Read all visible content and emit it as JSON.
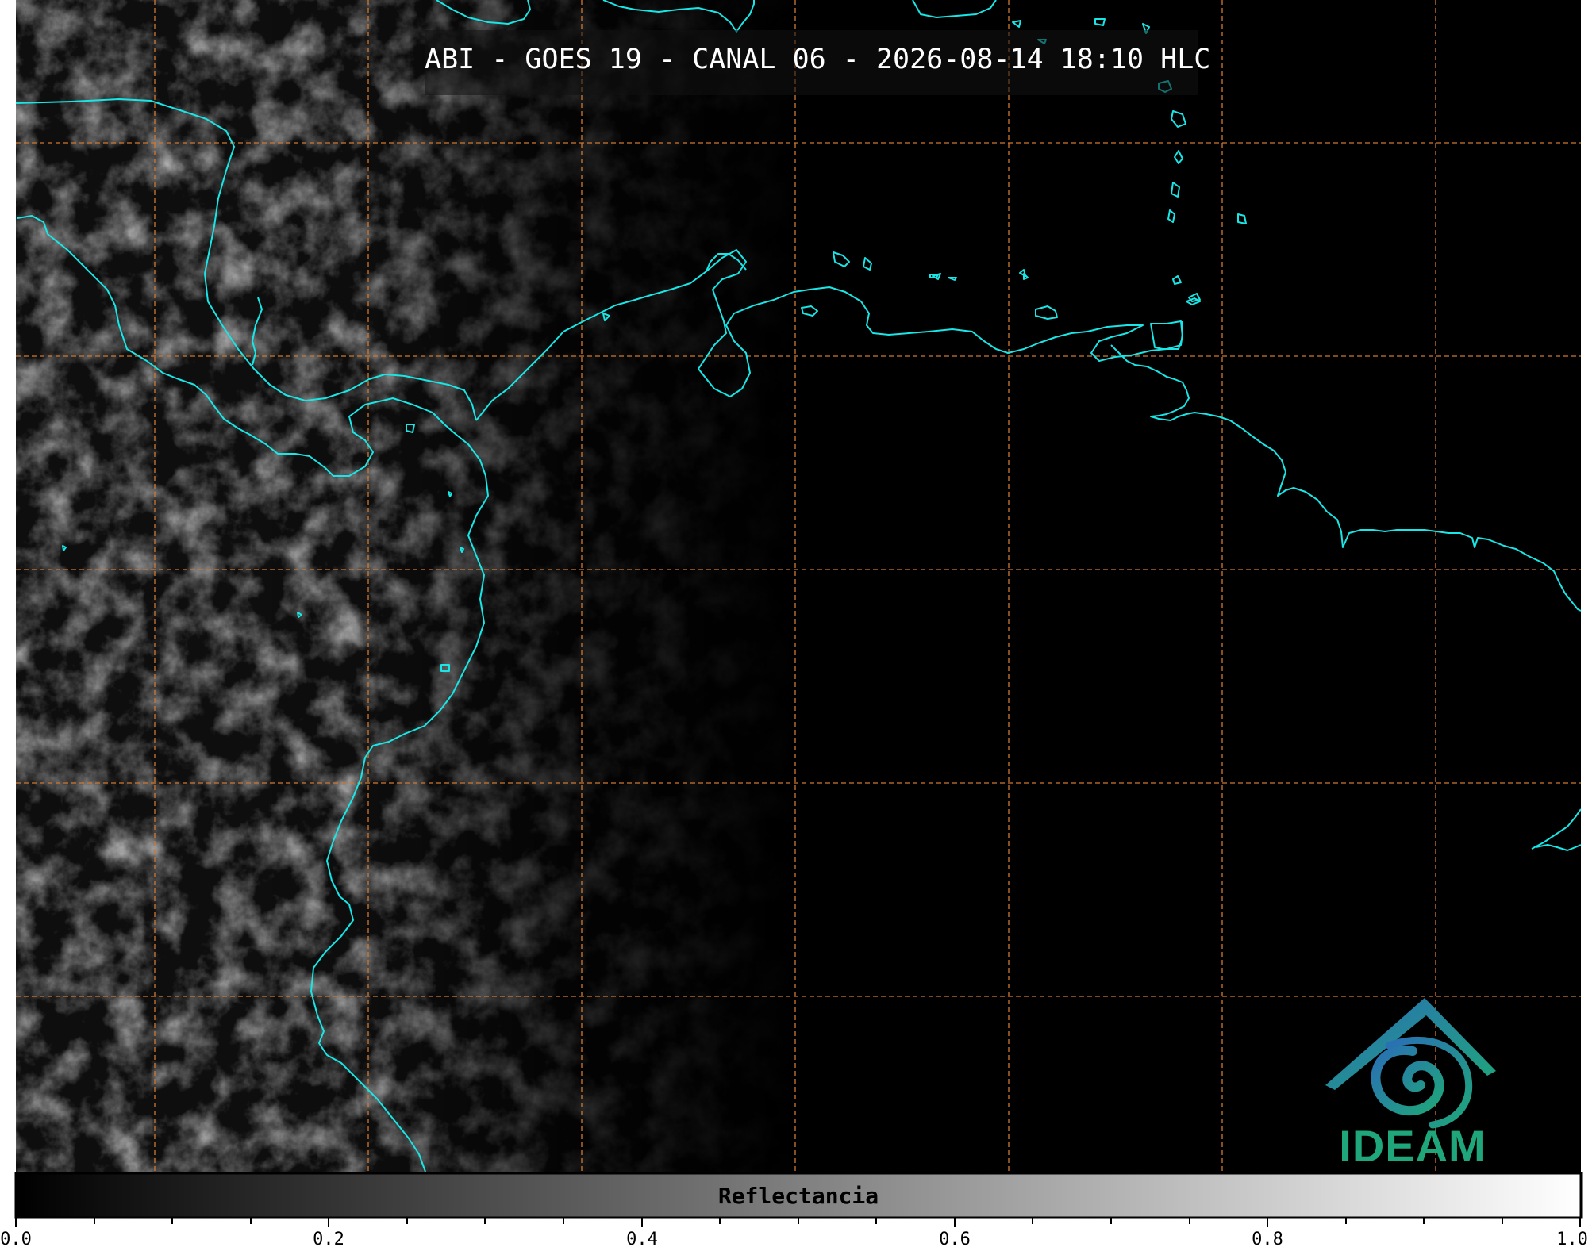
{
  "title": "ABI - GOES 19 - CANAL 06 - 2026-08-14 18:10 HLC",
  "colorbar": {
    "label": "Reflectancia",
    "ticks": [
      "0.0",
      "0.2",
      "0.4",
      "0.6",
      "0.8",
      "1.0"
    ],
    "range": [
      0.0,
      1.0
    ],
    "colormap": [
      "#000000",
      "#ffffff"
    ]
  },
  "logo": {
    "text": "IDEAM"
  },
  "colors": {
    "coastline": "#19e6e6",
    "gridlines": "#d07830",
    "background": "#000000",
    "logo_blue": "#2a6fb5",
    "logo_green": "#1fa67a"
  }
}
